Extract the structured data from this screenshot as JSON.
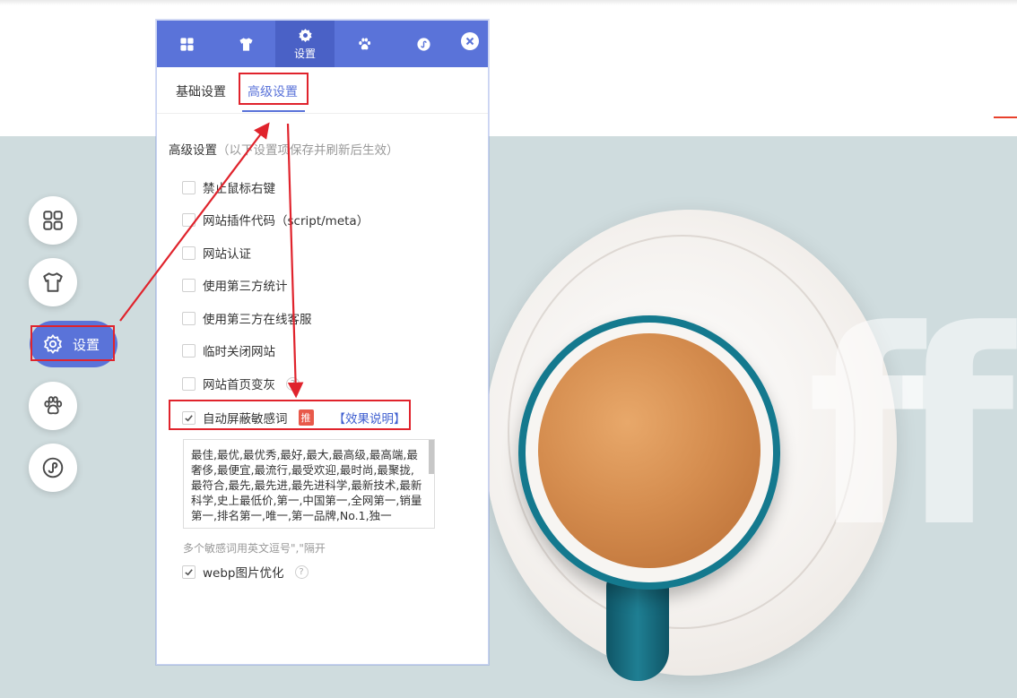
{
  "panel": {
    "head_tabs": [
      {
        "name": "layout",
        "icon": "grid-icon",
        "label": ""
      },
      {
        "name": "theme",
        "icon": "tshirt-icon",
        "label": ""
      },
      {
        "name": "settings",
        "icon": "gear-icon",
        "label": "设置",
        "active": true
      },
      {
        "name": "traces",
        "icon": "paw-icon",
        "label": ""
      },
      {
        "name": "miniprogram",
        "icon": "miniprogram-icon",
        "label": ""
      }
    ],
    "close_icon": "close-icon",
    "subtabs": {
      "basic": "基础设置",
      "advanced": "高级设置"
    },
    "section_title": "高级设置",
    "section_note": "（以下设置项保存并刷新后生效）",
    "options": [
      {
        "label": "禁止鼠标右键",
        "checked": false
      },
      {
        "label": "网站插件代码（script/meta）",
        "checked": false
      },
      {
        "label": "网站认证",
        "checked": false
      },
      {
        "label": "使用第三方统计",
        "checked": false
      },
      {
        "label": "使用第三方在线客服",
        "checked": false
      },
      {
        "label": "临时关闭网站",
        "checked": false
      },
      {
        "label": "网站首页变灰",
        "checked": false,
        "help": "?"
      }
    ],
    "sensitive": {
      "label": "自动屏蔽敏感词",
      "badge": "推",
      "link": "【效果说明】",
      "checked": true,
      "words": "最佳,最优,最优秀,最好,最大,最高级,最高端,最奢侈,最便宜,最流行,最受欢迎,最时尚,最聚拢,最符合,最先,最先进,最先进科学,最新技术,最新科学,史上最低价,第一,中国第一,全网第一,销量第一,排名第一,唯一,第一品牌,No.1,独一",
      "hint": "多个敏感词用英文逗号\",\"隔开"
    },
    "webp": {
      "label": "webp图片优化",
      "checked": true,
      "help": "?"
    }
  },
  "side_nav": {
    "items": [
      {
        "icon": "grid-icon"
      },
      {
        "icon": "tshirt-icon"
      },
      {
        "icon": "gear-icon",
        "label": "设置",
        "active": true
      },
      {
        "icon": "paw-icon"
      },
      {
        "icon": "miniprogram-icon"
      }
    ]
  },
  "background": {
    "letters": "ff"
  },
  "colors": {
    "accent": "#5a73d9",
    "annotation": "#e0232c",
    "hero_bg": "#cfdcde"
  }
}
